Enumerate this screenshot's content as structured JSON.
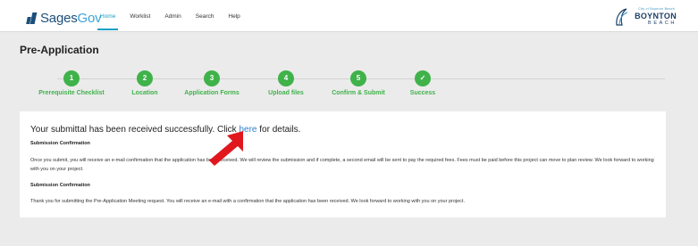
{
  "header": {
    "logo_text_sages": "Sages",
    "logo_text_gov": "Gov",
    "nav": [
      {
        "label": "Home",
        "active": true
      },
      {
        "label": "Worklist",
        "active": false
      },
      {
        "label": "Admin",
        "active": false
      },
      {
        "label": "Search",
        "active": false
      },
      {
        "label": "Help",
        "active": false
      }
    ],
    "city_logo": {
      "small": "City of Boynton Beach",
      "main": "BOYNTON",
      "sub": "BEACH"
    }
  },
  "page": {
    "title": "Pre-Application"
  },
  "steps": [
    {
      "number": "1",
      "label": "Prerequisite Checklist"
    },
    {
      "number": "2",
      "label": "Location"
    },
    {
      "number": "3",
      "label": "Application Forms"
    },
    {
      "number": "4",
      "label": "Upload files"
    },
    {
      "number": "5",
      "label": "Confirm & Submit"
    },
    {
      "number": "✓",
      "label": "Success"
    }
  ],
  "content": {
    "message_prefix": "Your submittal has been received successfully. Click ",
    "message_link": "here",
    "message_suffix": " for details.",
    "section1_title": "Submission Confirmation",
    "section1_body": "Once you submit, you will receive an e-mail confirmation that the application has been received. We will review the submission and if complete, a second email will be sent to pay the required fees. Fees must be paid before this project can move to plan review.  We look forward to working with you on your project.",
    "section2_title": "Submission Confirmation",
    "section2_body": "Thank you for submitting the Pre-Application Meeting request. You will receive an e-mail with a confirmation that the application has been received.  We look forward to working with you on your project."
  },
  "colors": {
    "accent": "#1b9fc6",
    "step_green": "#3fb24a",
    "link_blue": "#2e7fd0",
    "arrow_red": "#e0181e"
  }
}
